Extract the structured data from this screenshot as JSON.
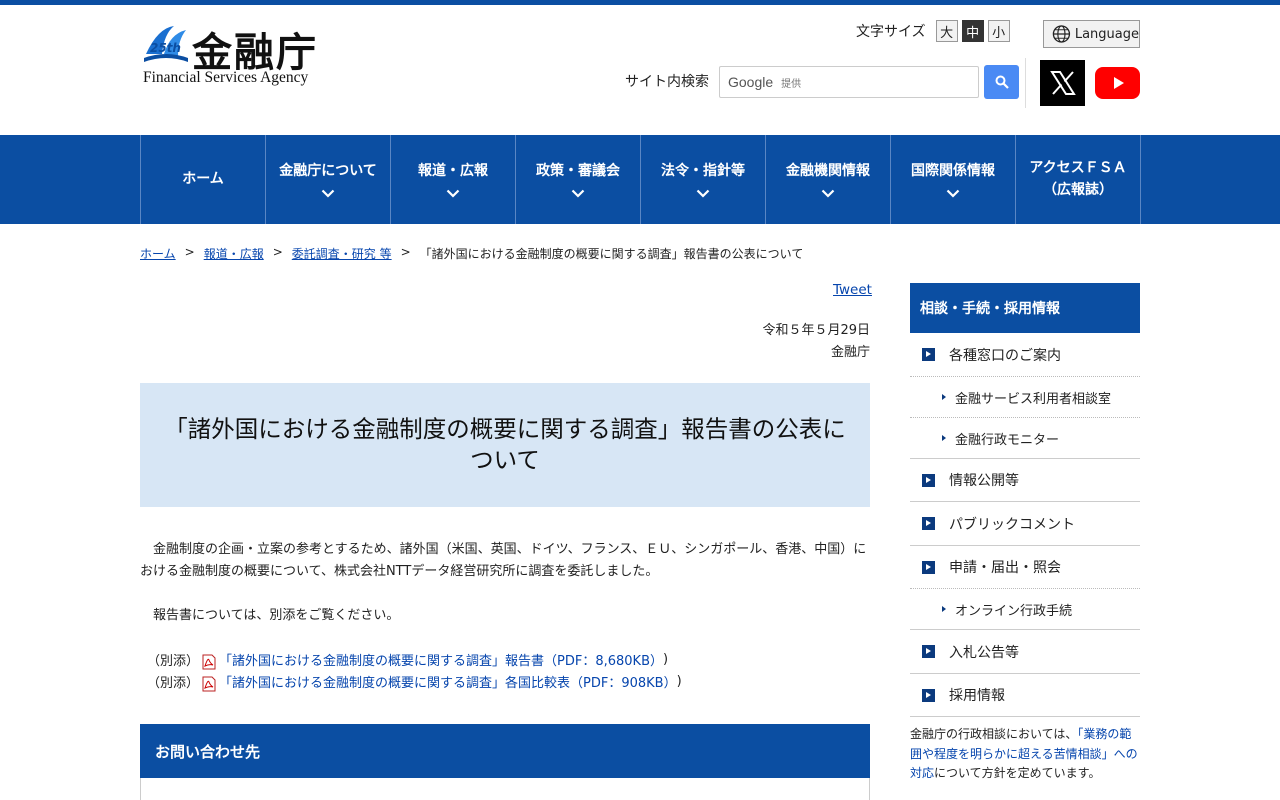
{
  "header": {
    "logo_kanji": "金融庁",
    "logo_english": "Financial Services Agency",
    "logo_badge": "25th",
    "font_size_label": "文字サイズ",
    "font_sizes": [
      "大",
      "中",
      "小"
    ],
    "font_size_selected": "中",
    "language_label": "Language",
    "search_label": "サイト内検索",
    "search_google": "Google",
    "search_provided": "提供"
  },
  "nav": {
    "items": [
      {
        "label": "ホーム"
      },
      {
        "label": "金融庁について"
      },
      {
        "label": "報道・広報"
      },
      {
        "label": "政策・審議会"
      },
      {
        "label": "法令・指針等"
      },
      {
        "label": "金融機関情報"
      },
      {
        "label": "国際関係情報"
      },
      {
        "label": "アクセスＦＳＡ"
      },
      {
        "label": "（広報誌）"
      }
    ]
  },
  "breadcrumb": {
    "home": "ホーム",
    "level1": "報道・広報",
    "level2": "委託調査・研究 等",
    "current": "「諸外国における金融制度の概要に関する調査」報告書の公表について",
    "separator": ">"
  },
  "main": {
    "tweet": "Tweet",
    "date": "令和５年５月29日",
    "issuer": "金融庁",
    "title": "「諸外国における金融制度の概要に関する調査」報告書の公表について",
    "paragraph1": "金融制度の企画・立案の参考とするため、諸外国（米国、英国、ドイツ、フランス、ＥＵ、シンガポール、香港、中国）における金融制度の概要について、株式会社NTTデータ経営研究所に調査を委託しました。",
    "paragraph2": "報告書については、別添をご覧ください。",
    "attachments": [
      {
        "tag": "（別添）",
        "link": "「諸外国における金融制度の概要に関する調査」報告書（PDF：8,680KB）",
        "close": ")"
      },
      {
        "tag": "（別添）",
        "link": "「諸外国における金融制度の概要に関する調査」各国比較表（PDF：908KB）",
        "close": ")"
      }
    ],
    "contact_heading": "お問い合わせ先"
  },
  "side": {
    "heading": "相談・手続・採用情報",
    "items": [
      {
        "label": "各種窓口のご案内"
      },
      {
        "label": "金融サービス利用者相談室"
      },
      {
        "label": "金融行政モニター"
      },
      {
        "label": "情報公開等"
      },
      {
        "label": "パブリックコメント"
      },
      {
        "label": "申請・届出・照会"
      },
      {
        "label": "オンライン行政手続"
      },
      {
        "label": "入札公告等"
      },
      {
        "label": "採用情報"
      }
    ],
    "note_before": "金融庁の行政相談においては、",
    "note_link": "「業務の範囲や程度を明らかに超える苦情相談」への対応",
    "note_after": "について方針を定めています。"
  },
  "colors": {
    "brand_blue": "#0b4ea2",
    "title_bg": "#d7e6f5",
    "link": "#0645ad"
  }
}
